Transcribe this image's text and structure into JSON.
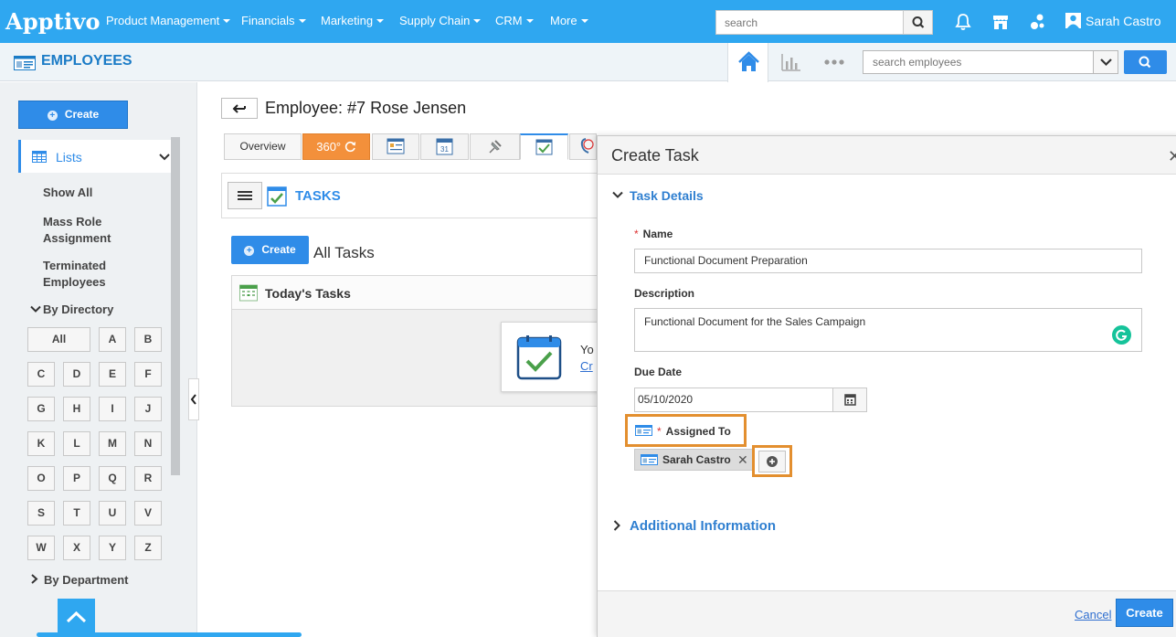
{
  "brand": {
    "logo": "Apptivo"
  },
  "nav": {
    "items": [
      {
        "label": "Product Management",
        "has_caret": true
      },
      {
        "label": "Financials",
        "has_caret": true
      },
      {
        "label": "Marketing",
        "has_caret": true
      },
      {
        "label": "Supply Chain",
        "has_caret": true
      },
      {
        "label": "CRM",
        "has_caret": true
      },
      {
        "label": "More",
        "has_caret": true
      }
    ],
    "search_placeholder": "search",
    "user_name": "Sarah Castro"
  },
  "app": {
    "title": "EMPLOYEES",
    "search_placeholder": "search employees"
  },
  "sidebar": {
    "create_label": "Create",
    "lists_label": "Lists",
    "links": [
      "Show All",
      "Mass Role Assignment",
      "Terminated Employees"
    ],
    "by_directory_label": "By Directory",
    "letters": [
      "All",
      "A",
      "B",
      "C",
      "D",
      "E",
      "F",
      "G",
      "H",
      "I",
      "J",
      "K",
      "L",
      "M",
      "N",
      "O",
      "P",
      "Q",
      "R",
      "S",
      "T",
      "U",
      "V",
      "W",
      "X",
      "Y",
      "Z"
    ],
    "by_department_label": "By Department"
  },
  "main": {
    "employee_title": "Employee: #7 Rose Jensen",
    "tabs": {
      "overview": "Overview",
      "t360": "360°"
    },
    "tasks_title": "TASKS",
    "create_label": "Create",
    "all_tasks_label": "All Tasks",
    "todays_tasks_label": "Today's Tasks",
    "empty_text_partial": "Yo",
    "empty_link_partial": "Cr"
  },
  "modal": {
    "title": "Create Task",
    "section_task_details": "Task Details",
    "name_label": "Name",
    "name_value": "Functional Document Preparation",
    "description_label": "Description",
    "description_value": "Functional Document for the Sales Campaign",
    "due_date_label": "Due Date",
    "due_date_value": "05/10/2020",
    "assigned_to_label": "Assigned To",
    "assignee": "Sarah Castro",
    "section_additional": "Additional Information",
    "cancel_label": "Cancel",
    "create_label": "Create"
  },
  "colors": {
    "brand_blue": "#2fa7f0",
    "accent_blue": "#2f8ce8",
    "highlight_orange": "#e38f2f",
    "tab_360_orange": "#f3903b"
  }
}
